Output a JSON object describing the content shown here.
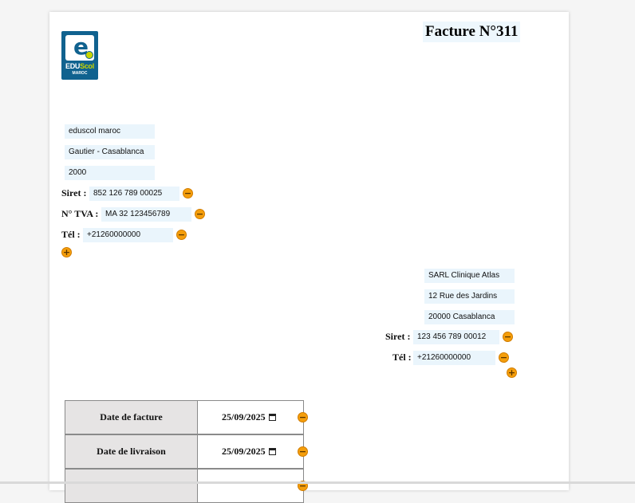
{
  "invoice": {
    "title": "Facture N°311"
  },
  "logo": {
    "brand_edu": "EDU",
    "brand_scol": "Scol",
    "brand_sub": "MAROC",
    "icon": "eduscol-logo"
  },
  "sender": {
    "name": "eduscol maroc",
    "address": "Gautier - Casablanca",
    "postal": "2000",
    "siret_label": "Siret :",
    "siret_value": "852 126 789 00025",
    "tva_label": "N° TVA :",
    "tva_value": "MA 32 123456789",
    "tel_label": "Tél :",
    "tel_value": "+21260000000"
  },
  "client": {
    "name": "SARL Clinique Atlas",
    "address": "12 Rue des Jardins",
    "postal_city": "20000 Casablanca",
    "siret_label": "Siret :",
    "siret_value": "123 456 789 00012",
    "tel_label": "Tél :",
    "tel_value": "+21260000000"
  },
  "dates": {
    "rows": [
      {
        "label": "Date de facture",
        "value": "25/09/2025"
      },
      {
        "label": "Date de livraison",
        "value": "25/09/2025"
      },
      {
        "label": "",
        "value": ""
      }
    ]
  },
  "buttons": {
    "remove": "−",
    "add": "+"
  },
  "colors": {
    "accent": "#f59e0b",
    "field_bg": "#eaf5fc",
    "logo_bg": "#10628f",
    "label_cell_bg": "#e6e4e4"
  }
}
